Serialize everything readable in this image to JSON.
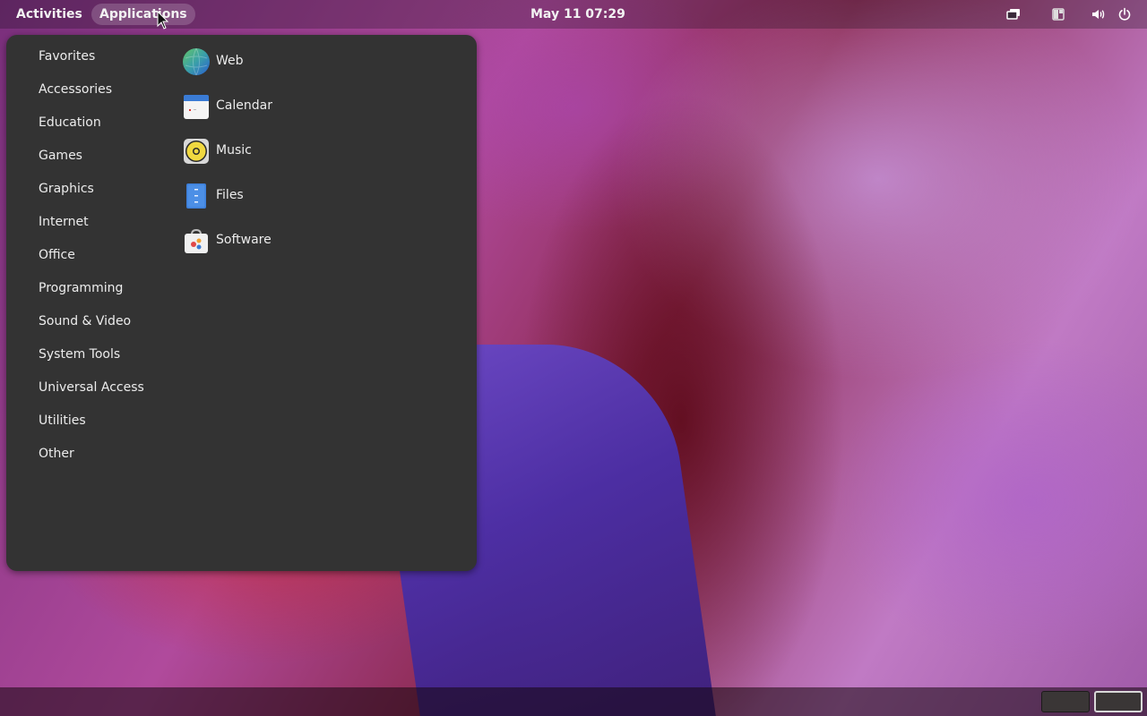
{
  "topbar": {
    "activities": "Activities",
    "applications": "Applications",
    "clock": "May 11  07:29",
    "tray_icons": [
      "display-icon",
      "window-layout-icon",
      "volume-icon",
      "power-icon"
    ]
  },
  "menu": {
    "categories": [
      "Favorites",
      "Accessories",
      "Education",
      "Games",
      "Graphics",
      "Internet",
      "Office",
      "Programming",
      "Sound & Video",
      "System Tools",
      "Universal Access",
      "Utilities",
      "Other"
    ],
    "apps": [
      {
        "label": "Web",
        "icon": "web-browser-icon"
      },
      {
        "label": "Calendar",
        "icon": "calendar-icon"
      },
      {
        "label": "Music",
        "icon": "music-icon"
      },
      {
        "label": "Files",
        "icon": "files-icon"
      },
      {
        "label": "Software",
        "icon": "software-icon"
      }
    ]
  },
  "workspaces": {
    "count": 2,
    "active_index": 1
  }
}
